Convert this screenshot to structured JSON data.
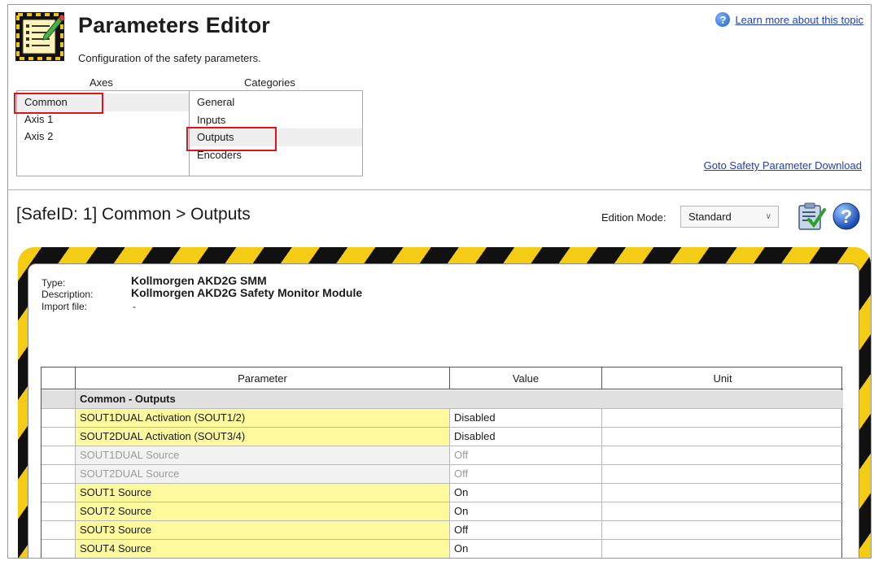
{
  "header": {
    "title": "Parameters Editor",
    "subtitle": "Configuration of the safety parameters.",
    "help_link": "Learn more about this topic"
  },
  "axes": {
    "label": "Axes",
    "items": [
      "Common",
      "Axis 1",
      "Axis 2"
    ],
    "selected": "Common"
  },
  "categories": {
    "label": "Categories",
    "items": [
      "General",
      "Inputs",
      "Outputs",
      "Encoders"
    ],
    "selected": "Outputs"
  },
  "goto_link": "Goto Safety Parameter Download",
  "section": {
    "title": "[SafeID: 1]  Common > Outputs",
    "edition_mode_label": "Edition Mode:",
    "edition_mode_value": "Standard"
  },
  "device_info": {
    "type_label": "Type:",
    "type_value": "Kollmorgen AKD2G SMM",
    "description_label": "Description:",
    "description_value": "Kollmorgen AKD2G Safety Monitor Module",
    "import_label": "Import file:",
    "import_value": "-"
  },
  "grid": {
    "columns": [
      "Parameter",
      "Value",
      "Unit"
    ],
    "group": "Common - Outputs",
    "rows": [
      {
        "parameter": "SOUT1DUAL Activation (SOUT1/2)",
        "value": "Disabled",
        "unit": "",
        "style": "editable"
      },
      {
        "parameter": "SOUT2DUAL Activation (SOUT3/4)",
        "value": "Disabled",
        "unit": "",
        "style": "editable"
      },
      {
        "parameter": "SOUT1DUAL Source",
        "value": "Off",
        "unit": "",
        "style": "disabled"
      },
      {
        "parameter": "SOUT2DUAL Source",
        "value": "Off",
        "unit": "",
        "style": "disabled"
      },
      {
        "parameter": "SOUT1 Source",
        "value": "On",
        "unit": "",
        "style": "editable"
      },
      {
        "parameter": "SOUT2 Source",
        "value": "On",
        "unit": "",
        "style": "editable"
      },
      {
        "parameter": "SOUT3 Source",
        "value": "Off",
        "unit": "",
        "style": "editable"
      },
      {
        "parameter": "SOUT4 Source",
        "value": "On",
        "unit": "",
        "style": "editable"
      }
    ]
  },
  "colors": {
    "highlight_box": "#e0131c",
    "editable_param_bg": "#fdfa9e",
    "hazard_yellow": "#f4cc16",
    "link": "#1a3fc4"
  },
  "icons": [
    "parameters-editor-icon",
    "help-icon",
    "clipboard-check-icon",
    "help-button-icon",
    "chevron-down-icon"
  ]
}
